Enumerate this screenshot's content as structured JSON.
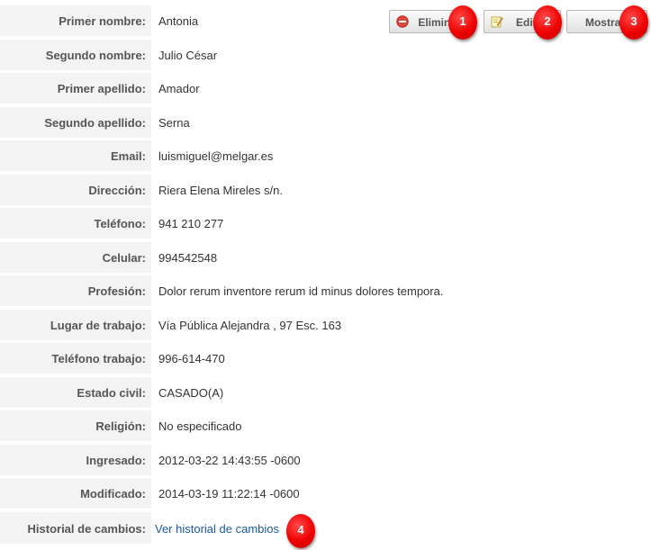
{
  "actions": {
    "delete_label": "Eliminar",
    "edit_label": "Editar",
    "show_label": "Mostrar"
  },
  "fields": [
    {
      "label": "Primer nombre:",
      "value": "Antonia"
    },
    {
      "label": "Segundo nombre:",
      "value": "Julio César"
    },
    {
      "label": "Primer apellido:",
      "value": "Amador"
    },
    {
      "label": "Segundo apellido:",
      "value": "Serna"
    },
    {
      "label": "Email:",
      "value": "luismiguel@melgar.es"
    },
    {
      "label": "Dirección:",
      "value": "Riera Elena Mireles s/n."
    },
    {
      "label": "Teléfono:",
      "value": "941 210 277"
    },
    {
      "label": "Celular:",
      "value": "994542548"
    },
    {
      "label": "Profesión:",
      "value": "Dolor rerum inventore rerum id minus dolores tempora."
    },
    {
      "label": "Lugar de trabajo:",
      "value": "Vía Pública Alejandra , 97 Esc. 163"
    },
    {
      "label": "Teléfono trabajo:",
      "value": "996-614-470"
    },
    {
      "label": "Estado civil:",
      "value": "CASADO(A)"
    },
    {
      "label": "Religión:",
      "value": "No especificado"
    },
    {
      "label": "Ingresado:",
      "value": "2012-03-22 14:43:55 -0600"
    },
    {
      "label": "Modificado:",
      "value": "2014-03-19 11:22:14 -0600"
    }
  ],
  "history": {
    "label": "Historial de cambios:",
    "link_text": "Ver historial de cambios"
  },
  "badges": [
    "1",
    "2",
    "3",
    "4"
  ],
  "colors": {
    "label_background": "#f3f3f3",
    "link": "#1a5aa0",
    "badge": "#ee0000"
  },
  "icons": {
    "delete": "delete-icon",
    "edit": "edit-icon"
  }
}
